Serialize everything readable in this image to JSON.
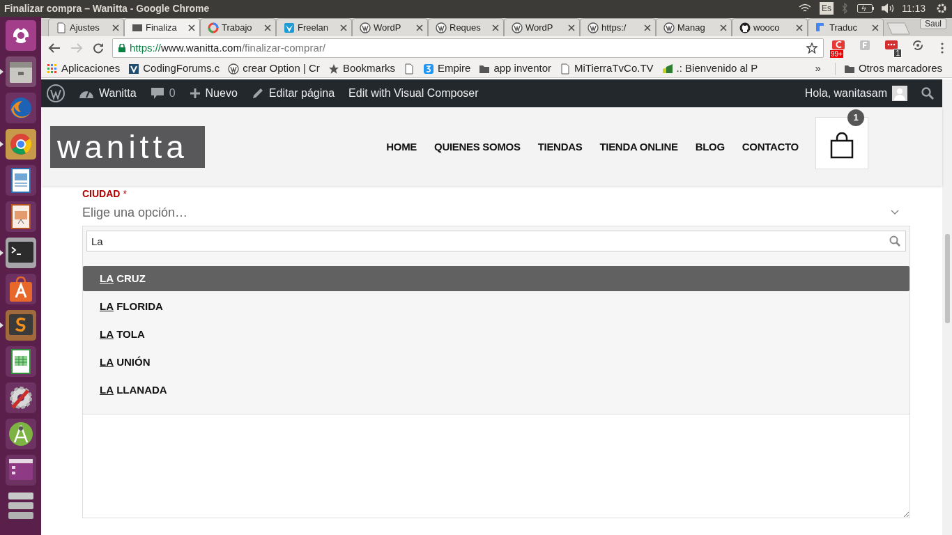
{
  "window": {
    "title": "Finalizar compra – Wanitta - Google Chrome"
  },
  "system_tray": {
    "keyboard": "Es",
    "clock": "11:13"
  },
  "launcher": [
    {
      "kind": "ubuntu",
      "running": false
    },
    {
      "kind": "files",
      "running": true
    },
    {
      "kind": "firefox",
      "running": false
    },
    {
      "kind": "chrome",
      "running": true
    },
    {
      "kind": "writer",
      "running": false
    },
    {
      "kind": "impress",
      "running": false
    },
    {
      "kind": "terminal",
      "running": true
    },
    {
      "kind": "software",
      "running": false
    },
    {
      "kind": "sublime",
      "running": true
    },
    {
      "kind": "calc",
      "running": false
    },
    {
      "kind": "settings",
      "running": false
    },
    {
      "kind": "android",
      "running": false
    },
    {
      "kind": "workspaces",
      "running": false
    },
    {
      "kind": "trash",
      "running": false
    }
  ],
  "tabs": [
    {
      "label": "Ajustes",
      "selected": false
    },
    {
      "label": "Finaliza",
      "selected": true
    },
    {
      "label": "Trabajo",
      "selected": false
    },
    {
      "label": "Freelan",
      "selected": false
    },
    {
      "label": "WordP",
      "selected": false
    },
    {
      "label": "Reques",
      "selected": false
    },
    {
      "label": "WordP",
      "selected": false
    },
    {
      "label": "https:/",
      "selected": false
    },
    {
      "label": "Manag",
      "selected": false
    },
    {
      "label": "wooco",
      "selected": false
    },
    {
      "label": "Traduc",
      "selected": false
    }
  ],
  "profile": "Saul",
  "address_bar": {
    "scheme": "https://",
    "host": "www.wanitta.com",
    "path": "/finalizar-comprar/"
  },
  "extensions": [
    {
      "kind": "c",
      "badge": "99+"
    },
    {
      "kind": "f"
    },
    {
      "kind": "dots",
      "badge": "1"
    },
    {
      "kind": "sync"
    }
  ],
  "bookmarks": [
    {
      "label": "Aplicaciones"
    },
    {
      "label": "CodingForums.c"
    },
    {
      "label": "crear Option | Cr"
    },
    {
      "label": "Bookmarks"
    },
    {
      "label": "Empire"
    },
    {
      "label": "app inventor"
    },
    {
      "label": "MiTierraTvCo.TV"
    },
    {
      "label": ".: Bienvenido al P"
    }
  ],
  "bookmarks_more": "»",
  "other_bookmarks": "Otros marcadores",
  "admin_bar": {
    "site": "Wanitta",
    "comments": "0",
    "new": "Nuevo",
    "edit": "Editar página",
    "composer": "Edit with Visual Composer",
    "greeting": "Hola, wanitasam"
  },
  "site_header": {
    "logo": "wanitta",
    "nav": [
      "HOME",
      "QUIENES SOMOS",
      "TIENDAS",
      "TIENDA ONLINE",
      "BLOG",
      "CONTACTO"
    ],
    "cart_count": "1"
  },
  "city_field": {
    "label": "CIUDAD",
    "required": "*",
    "placeholder": "Elige una opción…",
    "search": "La",
    "options": [
      {
        "match": "LA",
        "rest": " CRUZ",
        "selected": true
      },
      {
        "match": "LA",
        "rest": " FLORIDA",
        "selected": false
      },
      {
        "match": "LA",
        "rest": " TOLA",
        "selected": false
      },
      {
        "match": "LA",
        "rest": " UNIÓN",
        "selected": false
      },
      {
        "match": "LA",
        "rest": " LLANADA",
        "selected": false
      }
    ]
  }
}
